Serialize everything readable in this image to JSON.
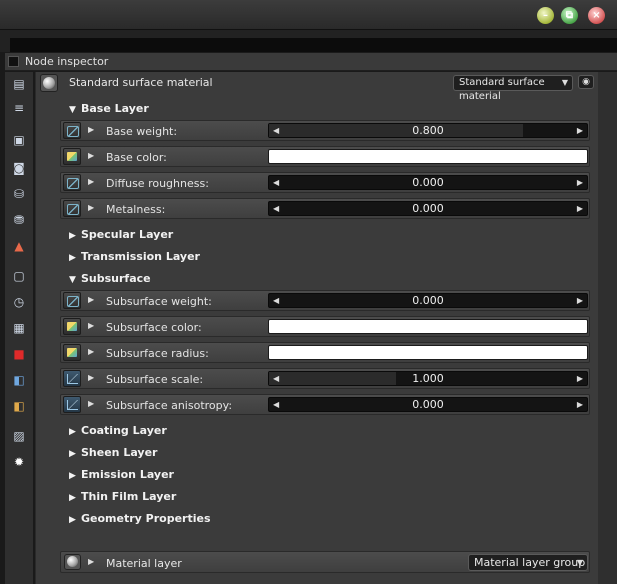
{
  "window": {
    "buttons": [
      {
        "name": "minimize",
        "glyph": "–",
        "color": "#a6b83c"
      },
      {
        "name": "maximize",
        "glyph": "⧉",
        "color": "#4aa64a"
      },
      {
        "name": "close",
        "glyph": "×",
        "color": "#d45656"
      }
    ]
  },
  "inspector": {
    "title": "Node inspector"
  },
  "sidebar": {
    "icons": [
      "layers-icon",
      "list-icon",
      "image-icon",
      "camera-icon",
      "database-icon",
      "database-gear-icon",
      "shapes-icon",
      "frame-icon",
      "clock-icon",
      "texture-icon",
      "red-cube-icon",
      "blue-cubes-icon",
      "orange-cubes-icon",
      "picture-icon",
      "light-icon"
    ]
  },
  "material": {
    "title": "Standard surface material",
    "type_dropdown": "Standard surface material",
    "visibility_icon": "eye-icon"
  },
  "sections": {
    "base_layer": "Base Layer",
    "specular_layer": "Specular Layer",
    "transmission_layer": "Transmission Layer",
    "subsurface": "Subsurface",
    "coating_layer": "Coating Layer",
    "sheen_layer": "Sheen Layer",
    "emission_layer": "Emission Layer",
    "thin_film_layer": "Thin Film Layer",
    "geometry_properties": "Geometry Properties"
  },
  "params": {
    "base_weight": {
      "label": "Base weight:",
      "value": "0.800",
      "fraction": 0.8
    },
    "base_color": {
      "label": "Base color:",
      "color": "#ffffff"
    },
    "diffuse_roughness": {
      "label": "Diffuse roughness:",
      "value": "0.000",
      "fraction": 0
    },
    "metalness": {
      "label": "Metalness:",
      "value": "0.000",
      "fraction": 0
    },
    "subsurface_weight": {
      "label": "Subsurface weight:",
      "value": "0.000",
      "fraction": 0
    },
    "subsurface_color": {
      "label": "Subsurface color:",
      "color": "#ffffff"
    },
    "subsurface_radius": {
      "label": "Subsurface radius:",
      "color": "#ffffff"
    },
    "subsurface_scale": {
      "label": "Subsurface scale:",
      "value": "1.000",
      "fraction": 0.4
    },
    "subsurface_anisotropy": {
      "label": "Subsurface anisotropy:",
      "value": "0.000",
      "fraction": 0
    }
  },
  "material_layer": {
    "label": "Material layer",
    "dropdown": "Material layer group"
  }
}
